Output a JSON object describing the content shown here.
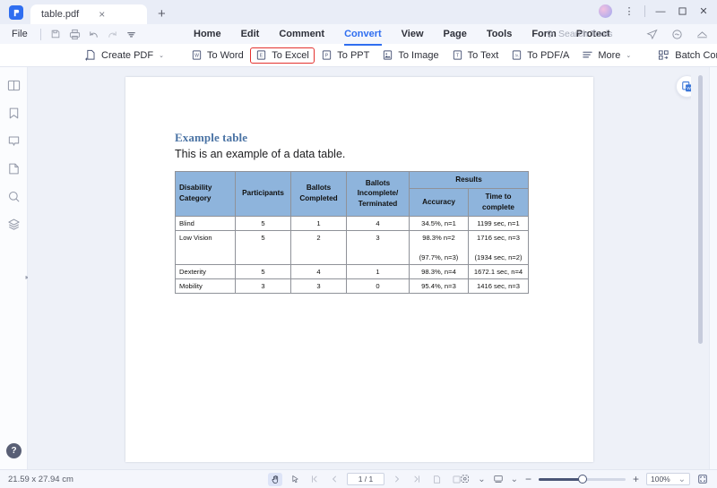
{
  "window": {
    "tab_title": "table.pdf",
    "tab_close": "×",
    "new_tab": "+",
    "minimize": "—",
    "maximize": "☐",
    "close": "✕",
    "more_options": "⋮"
  },
  "menu": {
    "file_label": "File",
    "items": [
      {
        "label": "Home",
        "active": false
      },
      {
        "label": "Edit",
        "active": false
      },
      {
        "label": "Comment",
        "active": false
      },
      {
        "label": "Convert",
        "active": true
      },
      {
        "label": "View",
        "active": false
      },
      {
        "label": "Page",
        "active": false
      },
      {
        "label": "Tools",
        "active": false
      },
      {
        "label": "Form",
        "active": false
      },
      {
        "label": "Protect",
        "active": false
      }
    ],
    "search_tools_placeholder": "Search Tools",
    "quick_icons": [
      "save-icon",
      "print-icon",
      "undo-icon",
      "redo-icon",
      "customize-caret-icon"
    ],
    "right_icons": [
      "share-icon",
      "cloud-icon",
      "upload-icon"
    ]
  },
  "ribbon": {
    "items": [
      {
        "label": "Create PDF",
        "icon": "create-pdf-icon",
        "caret": "⌄",
        "selected": false
      },
      {
        "label": "To Word",
        "icon": "to-word-icon",
        "caret": "",
        "selected": false
      },
      {
        "label": "To Excel",
        "icon": "to-excel-icon",
        "caret": "",
        "selected": true
      },
      {
        "label": "To PPT",
        "icon": "to-ppt-icon",
        "caret": "",
        "selected": false
      },
      {
        "label": "To Image",
        "icon": "to-image-icon",
        "caret": "",
        "selected": false
      },
      {
        "label": "To Text",
        "icon": "to-text-icon",
        "caret": "",
        "selected": false
      },
      {
        "label": "To PDF/A",
        "icon": "to-pdfa-icon",
        "caret": "",
        "selected": false
      },
      {
        "label": "More",
        "icon": "more-icon",
        "caret": "⌄",
        "selected": false
      },
      {
        "label": "Batch Convert",
        "icon": "batch-convert-icon",
        "caret": "",
        "selected": false
      }
    ]
  },
  "sidebar": {
    "items": [
      {
        "name": "thumbnails-panel-icon"
      },
      {
        "name": "bookmark-icon"
      },
      {
        "name": "comment-icon"
      },
      {
        "name": "page-icon"
      },
      {
        "name": "search-icon"
      },
      {
        "name": "layers-icon"
      }
    ],
    "help_label": "?"
  },
  "viewer": {
    "float_action": "to-word-quick-icon"
  },
  "document": {
    "heading": "Example table",
    "subheading": "This is an example of a data table.",
    "table": {
      "headers": {
        "disability_category": "Disability Category",
        "participants": "Participants",
        "ballots_completed": "Ballots Completed",
        "ballots_incomplete": "Ballots Incomplete/ Terminated",
        "results": "Results",
        "accuracy": "Accuracy",
        "time_to_complete": "Time to complete"
      },
      "rows": [
        {
          "category": "Blind",
          "participants": "5",
          "completed": "1",
          "incomplete": "4",
          "accuracy": [
            "34.5%, n=1"
          ],
          "time": [
            "1199 sec, n=1"
          ]
        },
        {
          "category": "Low Vision",
          "participants": "5",
          "completed": "2",
          "incomplete": "3",
          "accuracy": [
            "98.3% n=2",
            "(97.7%, n=3)"
          ],
          "time": [
            "1716 sec, n=3",
            "(1934 sec, n=2)"
          ]
        },
        {
          "category": "Dexterity",
          "participants": "5",
          "completed": "4",
          "incomplete": "1",
          "accuracy": [
            "98.3%, n=4"
          ],
          "time": [
            "1672.1 sec, n=4"
          ]
        },
        {
          "category": "Mobility",
          "participants": "3",
          "completed": "3",
          "incomplete": "0",
          "accuracy": [
            "95.4%, n=3"
          ],
          "time": [
            "1416 sec, n=3"
          ]
        }
      ]
    }
  },
  "status": {
    "page_dimensions": "21.59 x 27.94 cm",
    "hand_tool": "hand-tool-icon",
    "select_tool": "select-tool-icon",
    "first_page": "❘‹",
    "prev_page": "‹",
    "page_indicator": "1 / 1",
    "next_page": "›",
    "last_page": "›❘",
    "single_page_view": "single-page-view-icon",
    "facing_page_view": "facing-page-view-icon",
    "zoom_out": "−",
    "zoom_in": "+",
    "zoom_level": "100%",
    "zoom_caret": "⌄",
    "fit_screen": "fit-screen-icon"
  },
  "colors": {
    "accent": "#2f6ef0",
    "table_header": "#8eb4dc",
    "heading": "#4a73a4",
    "selection_outline": "#e4322f"
  }
}
